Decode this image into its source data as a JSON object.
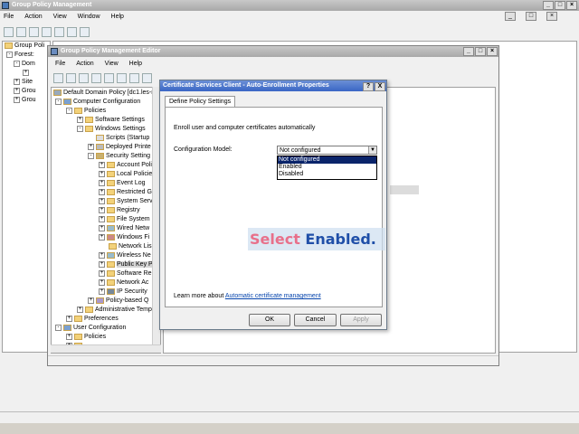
{
  "outer": {
    "title": "Group Policy Management",
    "menu": [
      "File",
      "Action",
      "View",
      "Window",
      "Help"
    ],
    "tree": [
      {
        "label": "Group Poli"
      },
      {
        "label": "Forest:"
      },
      {
        "label": "Dom"
      },
      {
        "label": ""
      },
      {
        "label": "Site"
      },
      {
        "label": "Grou"
      },
      {
        "label": "Grou"
      }
    ]
  },
  "editor": {
    "title": "Group Policy Management Editor",
    "menu": [
      "File",
      "Action",
      "View",
      "Help"
    ],
    "tree": [
      {
        "label": "Default Domain Policy [dc1.les-n"
      },
      {
        "label": "Computer Configuration"
      },
      {
        "label": "Policies"
      },
      {
        "label": "Software Settings"
      },
      {
        "label": "Windows Settings"
      },
      {
        "label": "Scripts (Startup"
      },
      {
        "label": "Deployed Printe"
      },
      {
        "label": "Security Setting"
      },
      {
        "label": "Account Poli"
      },
      {
        "label": "Local Policie"
      },
      {
        "label": "Event Log"
      },
      {
        "label": "Restricted G"
      },
      {
        "label": "System Serv"
      },
      {
        "label": "Registry"
      },
      {
        "label": "File System"
      },
      {
        "label": "Wired Netw"
      },
      {
        "label": "Windows Fi"
      },
      {
        "label": "Network Lis"
      },
      {
        "label": "Wireless Ne"
      },
      {
        "label": "Public Key P"
      },
      {
        "label": "Software Re"
      },
      {
        "label": "Network Ac"
      },
      {
        "label": "IP Security"
      },
      {
        "label": "Policy-based Q"
      },
      {
        "label": "Administrative Temp"
      },
      {
        "label": "Preferences"
      },
      {
        "label": "User Configuration"
      },
      {
        "label": "Policies"
      },
      {
        "label": ""
      }
    ]
  },
  "dialog": {
    "title": "Certificate Services Client - Auto-Enrollment Properties",
    "help_btn": "?",
    "close_btn": "X",
    "tab": "Define Policy Settings",
    "description": "Enroll user and computer certificates automatically",
    "model_label": "Configuration Model:",
    "model_value": "Not configured",
    "options": [
      "Not configured",
      "Enabled",
      "Disabled"
    ],
    "learn_prefix": "Learn more about",
    "learn_link": "Automatic certificate management",
    "ok": "OK",
    "cancel": "Cancel",
    "apply": "Apply"
  },
  "callout": {
    "word1": "Select",
    "word2": "Enabled",
    "dot": "."
  },
  "colors": {
    "callout_pink": "#e8708a",
    "callout_blue": "#1f4fa8",
    "selection": "#0a246a"
  }
}
